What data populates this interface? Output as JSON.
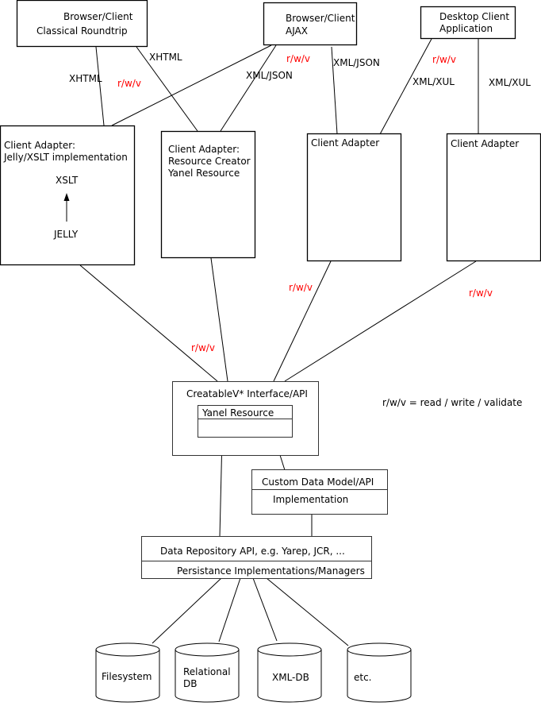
{
  "diagram": {
    "clients": {
      "classical": {
        "line1": "Browser/Client",
        "line2": "Classical Roundtrip"
      },
      "ajax": {
        "line1": "Browser/Client",
        "line2": "AJAX"
      },
      "desktop": {
        "line1": "Desktop Client",
        "line2": "Application"
      }
    },
    "adapters": {
      "jelly": {
        "line1": "Client Adapter:",
        "line2": "Jelly/XSLT implementation",
        "xslt": "XSLT",
        "jelly": "JELLY"
      },
      "resource": {
        "line1": "Client Adapter:",
        "line2": "Resource Creator",
        "line3": "Yanel Resource"
      },
      "ajax": {
        "line1": "Client Adapter"
      },
      "desktop": {
        "line1": "Client Adapter"
      }
    },
    "edge_labels": {
      "xhtml_left": "XHTML",
      "xhtml_right": "XHTML",
      "rwv_1": "r/w/v",
      "xmljson_1": "XML/JSON",
      "rwv_2": "r/w/v",
      "xmljson_2": "XML/JSON",
      "rwv_3": "r/w/v",
      "xmlxul_1": "XML/XUL",
      "xmlxul_2": "XML/XUL",
      "rwv_4": "r/w/v",
      "rwv_5": "r/w/v",
      "rwv_6": "r/w/v"
    },
    "creatable": {
      "title": "CreatableV* Interface/API",
      "inner": "Yanel Resource"
    },
    "legend": "r/w/v = read / write / validate",
    "custom_model": {
      "line1": "Custom Data Model/API",
      "line2": "Implementation"
    },
    "repository": {
      "line1": "Data Repository API, e.g. Yarep, JCR, ...",
      "line2": "Persistance Implementations/Managers"
    },
    "stores": {
      "filesystem": {
        "line1": "Filesystem"
      },
      "relational": {
        "line1": "Relational",
        "line2": "DB"
      },
      "xmldb": {
        "line1": "XML-DB"
      },
      "etc": {
        "line1": "etc."
      }
    },
    "colors": {
      "annotation": "#ff0000",
      "stroke": "#000000"
    }
  }
}
